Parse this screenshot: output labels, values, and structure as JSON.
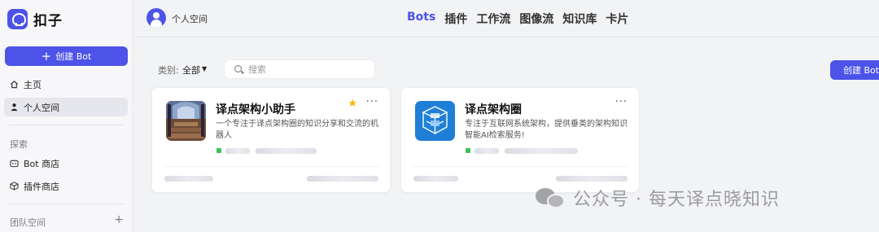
{
  "app": {
    "name": "扣子"
  },
  "sidebar": {
    "create_label": "创建 Bot",
    "items": [
      {
        "label": "主页",
        "icon": "home-icon",
        "active": false
      },
      {
        "label": "个人空间",
        "icon": "user-icon",
        "active": true
      }
    ],
    "explore_label": "探索",
    "explore_items": [
      {
        "label": "Bot 商店",
        "icon": "bot-store-icon"
      },
      {
        "label": "插件商店",
        "icon": "plugin-store-icon"
      }
    ],
    "team_label": "团队空间",
    "team_add": "+"
  },
  "header": {
    "workspace_name": "个人空间",
    "tabs": [
      {
        "label": "Bots",
        "active": true
      },
      {
        "label": "插件"
      },
      {
        "label": "工作流"
      },
      {
        "label": "图像流"
      },
      {
        "label": "知识库"
      },
      {
        "label": "卡片"
      }
    ]
  },
  "toolbar": {
    "category_label": "类别:",
    "category_value": "全部",
    "search_placeholder": "搜索",
    "create_label": "创建 Bot"
  },
  "cards": [
    {
      "title": "译点架构小助手",
      "description": "一个专注于译点架构圈的知识分享和交流的机器人",
      "starred": true,
      "more": "···"
    },
    {
      "title": "译点架构圈",
      "description": "专注于互联网系统架构，提供垂类的架构知识智能AI检索服务!",
      "starred": false,
      "more": "···"
    }
  ],
  "watermark": {
    "text": "公众号 · 每天译点晓知识"
  },
  "colors": {
    "accent": "#4d53e8",
    "status": "#3fbf5a",
    "star": "#f6b400"
  }
}
